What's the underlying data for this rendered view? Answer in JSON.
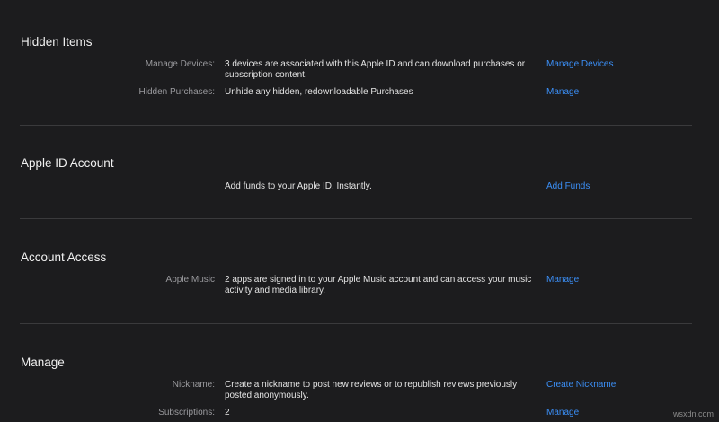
{
  "sections": [
    {
      "title": "Hidden Items",
      "rows": [
        {
          "label": "Manage Devices:",
          "description": "3 devices are associated with this Apple ID and can download purchases or subscription content.",
          "action": "Manage Devices"
        },
        {
          "label": "Hidden Purchases:",
          "description": "Unhide any hidden, redownloadable Purchases",
          "action": "Manage"
        }
      ]
    },
    {
      "title": "Apple ID Account",
      "rows": [
        {
          "label": "",
          "description": "Add funds to your Apple ID. Instantly.",
          "action": "Add Funds"
        }
      ]
    },
    {
      "title": "Account Access",
      "rows": [
        {
          "label": "Apple Music",
          "description": "2 apps are signed in to your Apple Music account and can access your music activity and media library.",
          "action": "Manage"
        }
      ]
    },
    {
      "title": "Manage",
      "rows": [
        {
          "label": "Nickname:",
          "description": "Create a nickname to post new reviews or to republish reviews previously posted anonymously.",
          "action": "Create Nickname"
        },
        {
          "label": "Subscriptions:",
          "description": "2",
          "action": "Manage"
        }
      ]
    }
  ],
  "watermark": "wsxdn.com",
  "colors": {
    "background": "#1c1c1e",
    "link": "#3b8ff7",
    "divider": "#3a3a3c",
    "label": "#9a9a9e"
  }
}
